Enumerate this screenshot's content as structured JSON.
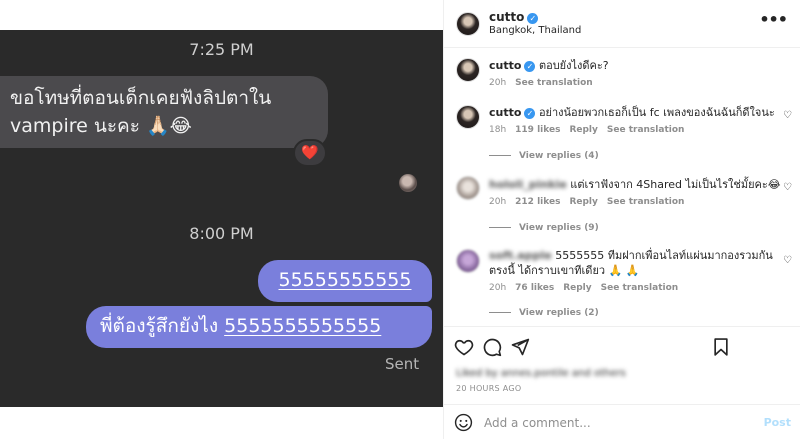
{
  "chat": {
    "time1": "7:25 PM",
    "incoming": "ขอโทษที่ตอนเด็กเคยฟังลิปตาใน vampire นะคะ 🙏🏻😂",
    "reaction": "❤️",
    "time2": "8:00 PM",
    "out1": "55555555555",
    "out2_prefix": "พี่ต้องรู้สึกยังไง ",
    "out2_link": "5555555555555",
    "status": "Sent"
  },
  "post": {
    "username": "cutto",
    "location": "Bangkok, Thailand",
    "more": "•••",
    "verified": "✓"
  },
  "comments": [
    {
      "username": "cutto",
      "text": "ตอบยังไงดีคะ?",
      "time": "20h",
      "see_translation": "See translation"
    },
    {
      "username": "cutto",
      "text": "อย่างน้อยพวกเธอก็เป็น fc เพลงของฉันฉันก็ดีใจนะ",
      "time": "18h",
      "likes": "119 likes",
      "reply": "Reply",
      "see_translation": "See translation",
      "view_replies": "View replies (4)"
    },
    {
      "username": "hololi_pinkie",
      "text": "แต่เราฟังจาก 4Shared ไม่เป็นไรใช่มั้ยคะ😂",
      "time": "20h",
      "likes": "212 likes",
      "reply": "Reply",
      "see_translation": "See translation",
      "view_replies": "View replies (9)"
    },
    {
      "username": "soft.apple",
      "text": "5555555 ทีมฝากเพื่อนไลท์แผ่นมากองรวมกันตรงนี้ ได้กราบเขาทีเดียว 🙏 🙏",
      "time": "20h",
      "likes": "76 likes",
      "reply": "Reply",
      "see_translation": "See translation",
      "view_replies": "View replies (2)"
    }
  ],
  "footer": {
    "liked_by": "Liked by annes.pontile and others",
    "ago": "20 HOURS AGO",
    "add_comment_placeholder": "Add a comment...",
    "post_label": "Post"
  }
}
